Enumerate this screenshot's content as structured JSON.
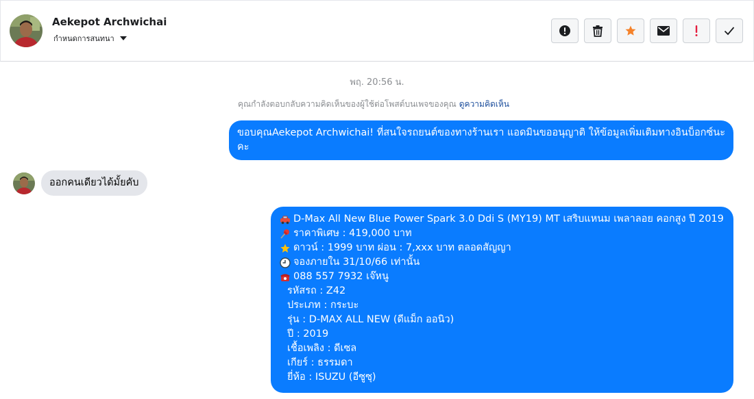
{
  "header": {
    "contact_name": "Aekepot Archwichai",
    "assign_label": "กำหนดการสนทนา",
    "actions": [
      {
        "icon": "alert-circle-icon",
        "color": "#1c1e21"
      },
      {
        "icon": "trash-icon",
        "color": "#1c1e21"
      },
      {
        "icon": "star-icon",
        "color": "#f5822a"
      },
      {
        "icon": "envelope-icon",
        "color": "#1c1e21"
      },
      {
        "icon": "exclamation-icon",
        "color": "#e41e3f"
      },
      {
        "icon": "checkmark-icon",
        "color": "#1c1e21"
      }
    ]
  },
  "thread": {
    "timestamp": "พฤ. 20:56 น.",
    "notice_text": "คุณกำลังตอบกลับความคิดเห็นของผู้ใช้ต่อโพสต์บนเพจของคุณ",
    "notice_link": "ดูความคิดเห็น",
    "messages": [
      {
        "direction": "out",
        "text": "ขอบคุณAekepot Archwichai! ที่สนใจรถยนต์ของทางร้านเรา แอดมินขออนุญาติ ให้ข้อมูลเพิ่มเติมทางอินบ็อกซ์นะคะ"
      },
      {
        "direction": "in",
        "text": "ออกคนเดียวได้มั้ยคับ"
      },
      {
        "direction": "out",
        "lines": [
          {
            "icon": "car-icon",
            "text": "D-Max All New Blue Power Spark 3.0 Ddi S (MY19) MT เสริบแหนม เพลาลอย คอกสูง ปี 2019"
          },
          {
            "icon": "pushpin-icon",
            "text": "ราคาพิเศษ : 419,000 บาท"
          },
          {
            "icon": "star-icon",
            "text": "ดาวน์ : 1999 บาท ผ่อน : 7,xxx บาท ตลอดสัญญา"
          },
          {
            "icon": "clock-icon",
            "text": "จองภายใน 31/10/66 เท่านั้น"
          },
          {
            "icon": "telephone-icon",
            "text": "088 557 7932  เจ๊หนู"
          },
          {
            "text": "รหัสรถ : Z42"
          },
          {
            "text": "ประเภท : กระบะ"
          },
          {
            "text": "รุ่น : D-MAX ALL NEW (ดีแม็ก ออนิว)"
          },
          {
            "text": "ปี : 2019"
          },
          {
            "text": "เชื้อเพลิง : ดีเซล"
          },
          {
            "text": "เกียร์ : ธรรมดา"
          },
          {
            "text": "ยี่ห้อ : ISUZU (อีซูซุ)"
          }
        ]
      }
    ]
  },
  "colors": {
    "outgoing_bubble": "#0a7cff",
    "incoming_bubble": "#e4e6eb",
    "link": "#1c4e9c"
  }
}
